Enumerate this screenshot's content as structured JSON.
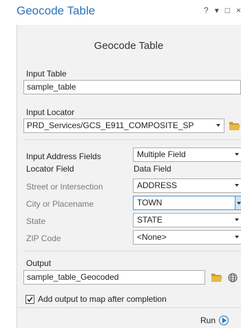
{
  "window": {
    "title": "Geocode Table",
    "controls": [
      "?",
      "▾",
      "□",
      "×"
    ]
  },
  "tool": {
    "heading": "Geocode Table",
    "input_table": {
      "label": "Input Table",
      "value": "sample_table"
    },
    "input_locator": {
      "label": "Input Locator",
      "value": "PRD_Services/GCS_E911_COMPOSITE_SP"
    },
    "address_fields": {
      "label": "Input Address Fields",
      "value": "Multiple Field"
    },
    "columns": {
      "locator_field": "Locator Field",
      "data_field": "Data Field"
    },
    "mappings": [
      {
        "label": "Street or Intersection",
        "value": "ADDRESS"
      },
      {
        "label": "City or Placename",
        "value": "TOWN"
      },
      {
        "label": "State",
        "value": "STATE"
      },
      {
        "label": "ZIP Code",
        "value": "<None>"
      }
    ],
    "output": {
      "label": "Output",
      "value": "sample_table_Geocoded"
    },
    "add_to_map": {
      "label": "Add output to map after completion",
      "checked": true
    },
    "run_label": "Run"
  },
  "colors": {
    "accent": "#2b73b6",
    "folder": "#e8b84a",
    "panel": "#f2f2f2"
  },
  "icons": {
    "folder": "folder-icon",
    "globe": "globe-icon",
    "run": "play-icon"
  }
}
